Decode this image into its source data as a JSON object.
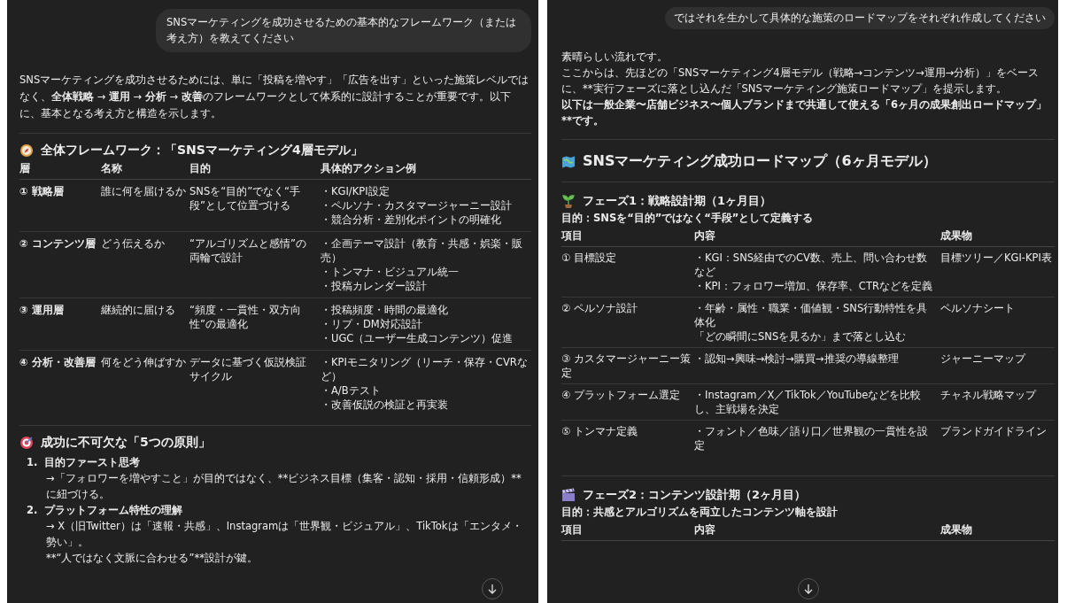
{
  "left_panel": {
    "user_message": "SNSマーケティングを成功させるための基本的なフレームワーク（または考え方）を教えてください",
    "intro": "SNSマーケティングを成功させるためには、単に「投稿を増やす」「広告を出す」といった施策レベルではなく、**全体戦略** → **運用** → **分析** → **改善**のフレームワークとして体系的に設計することが重要です。以下に、基本となる考え方と構造を示します。",
    "framework": {
      "heading": "全体フレームワーク：「SNSマーケティング4層モデル」",
      "columns": [
        "層",
        "名称",
        "目的",
        "具体的アクション例"
      ],
      "rows": [
        {
          "layer": "① 戦略層",
          "name": "誰に何を届けるか",
          "purpose": "SNSを“目的”でなく“手段”として位置づける",
          "actions": [
            "・KGI/KPI設定",
            "・ペルソナ・カスタマージャーニー設計",
            "・競合分析・差別化ポイントの明確化"
          ]
        },
        {
          "layer": "② コンテンツ層",
          "name": "どう伝えるか",
          "purpose": "“アルゴリズムと感情”の両輪で設計",
          "actions": [
            "・企画テーマ設計（教育・共感・娯楽・販売）",
            "・トンマナ・ビジュアル統一",
            "・投稿カレンダー設計"
          ]
        },
        {
          "layer": "③ 運用層",
          "name": "継続的に届ける",
          "purpose": "“頻度・一貫性・双方向性”の最適化",
          "actions": [
            "・投稿頻度・時間の最適化",
            "・リプ・DM対応設計",
            "・UGC（ユーザー生成コンテンツ）促進"
          ]
        },
        {
          "layer": "④ 分析・改善層",
          "name": "何をどう伸ばすか",
          "purpose": "データに基づく仮説検証サイクル",
          "actions": [
            "・KPIモニタリング（リーチ・保存・CVRなど）",
            "・A/Bテスト",
            "・改善仮説の検証と再実装"
          ]
        }
      ]
    },
    "principles": {
      "heading": "成功に不可欠な「5つの原則」",
      "items": [
        {
          "number": "1.",
          "title": "目的ファースト思考",
          "lines": [
            "→「フォロワーを増やすこと」が目的ではなく、**ビジネス目標（集客・認知・採用・信頼形成）**に紐づける。"
          ]
        },
        {
          "number": "2.",
          "title": "プラットフォーム特性の理解",
          "lines": [
            "→ X（旧Twitter）は「速報・共感」、Instagramは「世界観・ビジュアル」、TikTokは「エンタメ・勢い」。",
            "**“人ではなく文脈に合わせる”**設計が鍵。"
          ]
        }
      ]
    }
  },
  "right_panel": {
    "user_message": "ではそれを生かして具体的な施策のロードマップをそれぞれ作成してください",
    "intro_lines": [
      {
        "kind": "plain",
        "text": "素晴らしい流れです。"
      },
      {
        "kind": "plain",
        "text": "ここからは、先ほどの「SNSマーケティング4層モデル（戦略→コンテンツ→運用→分析）」をベースに、**実行フェーズに落とし込んだ「SNSマーケティング施策ロードマップ」を提示します。"
      },
      {
        "kind": "bold",
        "text": "以下は一般企業〜店舗ビジネス〜個人ブランドまで共通して使える「6ヶ月の成果創出ロードマップ」**です。"
      }
    ],
    "heading": "SNSマーケティング成功ロードマップ（6ヶ月モデル）",
    "phases": [
      {
        "heading": "フェーズ1：戦略設計期（1ヶ月目）",
        "goal": "目的：SNSを“目的”ではなく“手段”として定義する",
        "columns": [
          "項目",
          "内容",
          "成果物"
        ],
        "rows": [
          {
            "item": "① 目標設定",
            "content": [
              "・KGI：SNS経由でのCV数、売上、問い合わせ数など",
              "・KPI：フォロワー増加、保存率、CTRなどを定義"
            ],
            "deliverable": "目標ツリー／KGI-KPI表"
          },
          {
            "item": "② ペルソナ設計",
            "content": [
              "・年齢・属性・職業・価値観・SNS行動特性を具体化",
              "「どの瞬間にSNSを見るか」まで落とし込む"
            ],
            "deliverable": "ペルソナシート"
          },
          {
            "item": "③ カスタマージャーニー策定",
            "content": [
              "・認知→興味→検討→購買→推奨の導線整理"
            ],
            "deliverable": "ジャーニーマップ"
          },
          {
            "item": "④ プラットフォーム選定",
            "content": [
              "・Instagram／X／TikTok／YouTubeなどを比較し、主戦場を決定"
            ],
            "deliverable": "チャネル戦略マップ"
          },
          {
            "item": "⑤ トンマナ定義",
            "content": [
              "・フォント／色味／語り口／世界観の一貫性を設定"
            ],
            "deliverable": "ブランドガイドライン"
          }
        ]
      },
      {
        "heading": "フェーズ2：コンテンツ設計期（2ヶ月目）",
        "goal": "目的：共感とアルゴリズムを両立したコンテンツ軸を設計",
        "columns": [
          "項目",
          "内容",
          "成果物"
        ]
      }
    ]
  }
}
